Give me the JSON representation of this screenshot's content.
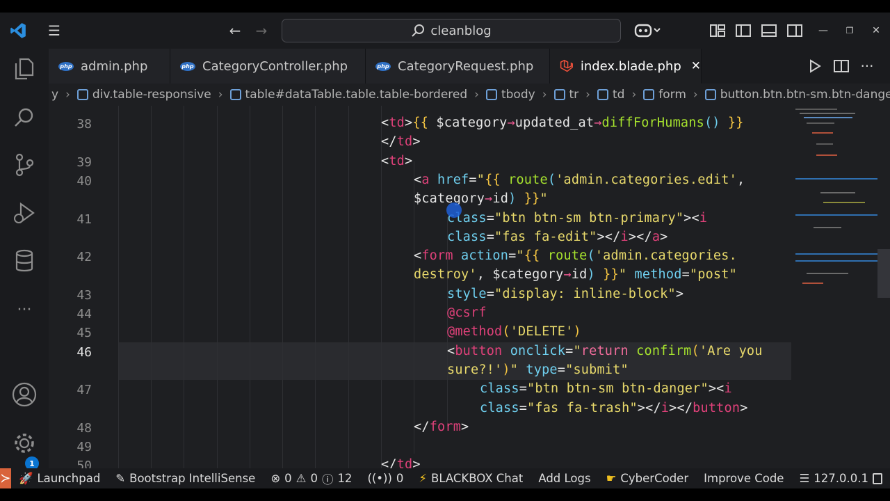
{
  "search": {
    "text": "cleanblog"
  },
  "tabs": [
    {
      "label": "admin.php",
      "type": "php"
    },
    {
      "label": "CategoryController.php",
      "type": "php"
    },
    {
      "label": "CategoryRequest.php",
      "type": "php"
    },
    {
      "label": "index.blade.php",
      "type": "laravel",
      "active": true,
      "close": "✕"
    }
  ],
  "breadcrumb": [
    "y",
    "div.table-responsive",
    "table#dataTable.table.table-bordered",
    "tbody",
    "tr",
    "td",
    "form",
    "button.btn.btn-sm.btn-danger"
  ],
  "line_numbers": [
    "38",
    "39",
    "40",
    "41",
    "42",
    "43",
    "44",
    "45",
    "46",
    "47",
    "48",
    "49",
    "50"
  ],
  "status": {
    "launchpad": "Launchpad",
    "bootstrap": "Bootstrap IntelliSense",
    "errors": "0",
    "warnings": "0",
    "infos": "12",
    "ports": "0",
    "blackbox": "BLACKBOX Chat",
    "add_logs": "Add Logs",
    "cybercoder": "CyberCoder",
    "improve": "Improve Code",
    "server": "127.0.0.1"
  },
  "badge": "1",
  "colors": {
    "accent": "#d9633b",
    "badge": "#0a74d0",
    "tag": "#e0417a",
    "attr": "#6fd0f0",
    "string": "#e8d96b"
  }
}
